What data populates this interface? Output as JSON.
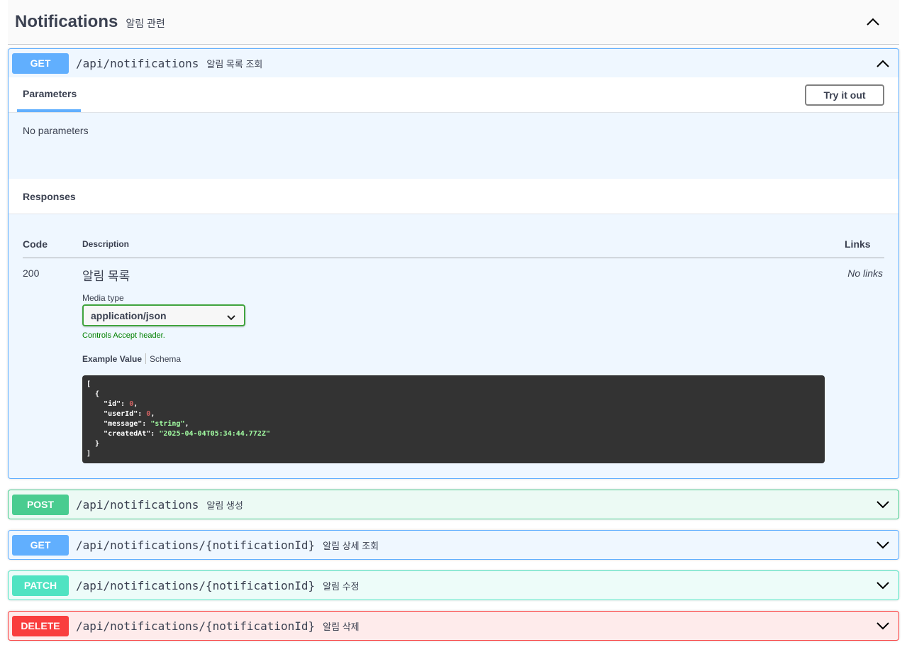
{
  "tag": {
    "title": "Notifications",
    "description": "알림 관련",
    "toggle_icon": "chevron-up-icon"
  },
  "operations": [
    {
      "method": "GET",
      "path": "/api/notifications",
      "summary": "알림 목록 조회",
      "expanded": true
    },
    {
      "method": "POST",
      "path": "/api/notifications",
      "summary": "알림 생성",
      "expanded": false
    },
    {
      "method": "GET",
      "path": "/api/notifications/{notificationId}",
      "summary": "알림 상세 조회",
      "expanded": false
    },
    {
      "method": "PATCH",
      "path": "/api/notifications/{notificationId}",
      "summary": "알림 수정",
      "expanded": false
    },
    {
      "method": "DELETE",
      "path": "/api/notifications/{notificationId}",
      "summary": "알림 삭제",
      "expanded": false
    }
  ],
  "detail": {
    "parameters_tab": "Parameters",
    "try_it_out": "Try it out",
    "no_parameters": "No parameters",
    "responses_title": "Responses",
    "table_headers": {
      "code": "Code",
      "description": "Description",
      "links": "Links"
    },
    "response": {
      "code": "200",
      "description": "알림 목록",
      "links": "No links",
      "media_type_label": "Media type",
      "media_type_value": "application/json",
      "controls_note": "Controls Accept header.",
      "example_tab": "Example Value",
      "schema_tab": "Schema",
      "example_lines": [
        {
          "text": "["
        },
        {
          "text": "  {"
        },
        {
          "key": "    \"id\": ",
          "val": "0",
          "vtype": "num",
          "tail": ","
        },
        {
          "key": "    \"userId\": ",
          "val": "0",
          "vtype": "num",
          "tail": ","
        },
        {
          "key": "    \"message\": ",
          "val": "\"string\"",
          "vtype": "str",
          "tail": ","
        },
        {
          "key": "    \"createdAt\": ",
          "val": "\"2025-04-04T05:34:44.772Z\"",
          "vtype": "str",
          "tail": ""
        },
        {
          "text": "  }"
        },
        {
          "text": "]"
        }
      ]
    }
  },
  "colors": {
    "get": "#61affe",
    "post": "#49cc90",
    "patch": "#50e3c2",
    "delete": "#f93e3e",
    "select_border": "#41a43e",
    "code_bg": "#333333"
  }
}
